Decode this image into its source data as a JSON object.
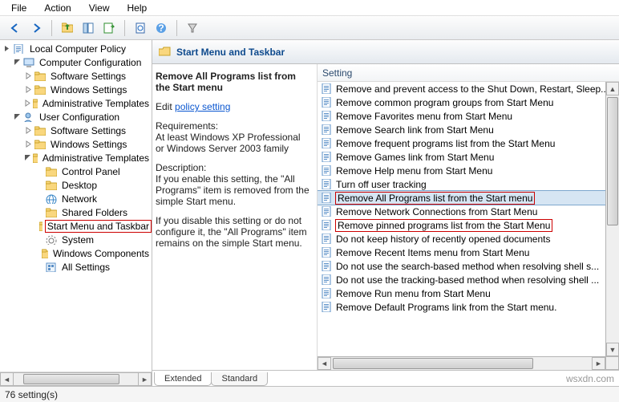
{
  "menu": {
    "file": "File",
    "action": "Action",
    "view": "View",
    "help": "Help"
  },
  "toolbar_icons": [
    "back",
    "forward",
    "up",
    "show-hide-tree",
    "export-list",
    "refresh",
    "help",
    "properties",
    "filter"
  ],
  "tree": {
    "root": "Local Computer Policy",
    "computer_config": "Computer Configuration",
    "cc_children": [
      "Software Settings",
      "Windows Settings",
      "Administrative Templates"
    ],
    "user_config": "User Configuration",
    "uc_children": [
      "Software Settings",
      "Windows Settings",
      "Administrative Templates"
    ],
    "admin_children": [
      "Control Panel",
      "Desktop",
      "Network",
      "Shared Folders",
      "Start Menu and Taskbar",
      "System",
      "Windows Components",
      "All Settings"
    ],
    "selected": "Start Menu and Taskbar"
  },
  "header": {
    "title": "Start Menu and Taskbar"
  },
  "desc": {
    "title": "Remove All Programs list from the Start menu",
    "edit_prefix": "Edit ",
    "edit_link": "policy setting ",
    "req_label": "Requirements:",
    "req_text": "At least Windows XP Professional or Windows Server 2003 family",
    "d_label": "Description:",
    "d_text1": "If you enable this setting, the \"All Programs\" item is removed from the simple Start menu.",
    "d_text2": "If you disable this setting or do not configure it, the \"All Programs\" item remains on the simple Start menu."
  },
  "column": "Setting",
  "settings": [
    "Remove and prevent access to the Shut Down, Restart, Sleep...",
    "Remove common program groups from Start Menu",
    "Remove Favorites menu from Start Menu",
    "Remove Search link from Start Menu",
    "Remove frequent programs list from the Start Menu",
    "Remove Games link from Start Menu",
    "Remove Help menu from Start Menu",
    "Turn off user tracking",
    "Remove All Programs list from the Start menu",
    "Remove Network Connections from Start Menu",
    "Remove pinned programs list from the Start Menu",
    "Do not keep history of recently opened documents",
    "Remove Recent Items menu from Start Menu",
    "Do not use the search-based method when resolving shell s...",
    "Do not use the tracking-based method when resolving shell ...",
    "Remove Run menu from Start Menu",
    "Remove Default Programs link from the Start menu."
  ],
  "selected_setting_index": 8,
  "highlight_indices": [
    8,
    10
  ],
  "tabs": {
    "extended": "Extended",
    "standard": "Standard"
  },
  "status": "76 setting(s)",
  "watermark": "wsxdn.com"
}
